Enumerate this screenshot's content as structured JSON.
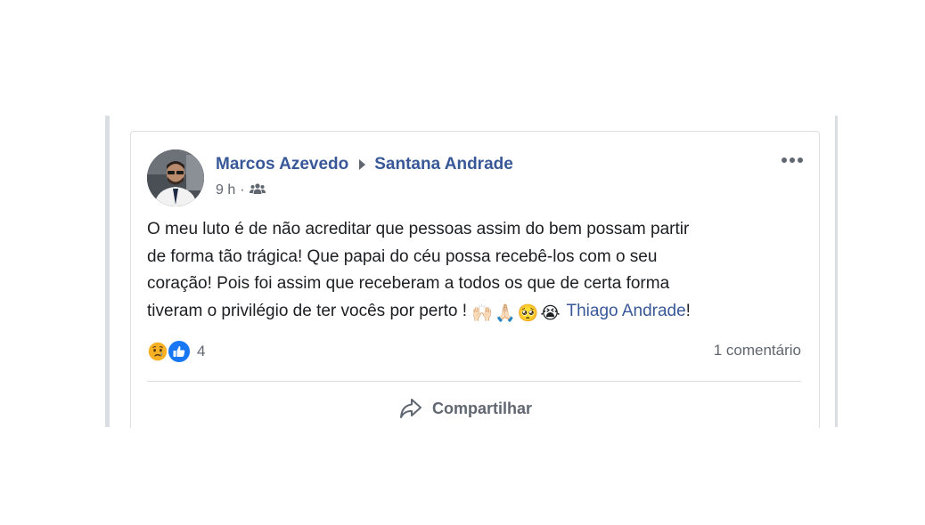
{
  "post": {
    "author": "Marcos Azevedo",
    "recipient": "Santana Andrade",
    "time": "9 h",
    "separator": "·",
    "audience_icon": "friends-icon",
    "more_icon": "more-options-icon",
    "text_lines": [
      "O meu luto é de não acreditar que pessoas assim do bem possam partir",
      "de forma tão trágica! Que papai do céu possa recebê-los com o seu",
      "coração! Pois foi assim que receberam a todos os que de certa forma",
      "tiveram o privilégio de ter vocês por perto ! "
    ],
    "emojis": [
      "🙌🏻",
      "🙏🏻",
      "🥺",
      "😭"
    ],
    "mention": "Thiago Andrade",
    "mention_suffix": "!"
  },
  "reactions": {
    "icons": [
      "sad-reaction-icon",
      "like-reaction-icon"
    ],
    "count": "4"
  },
  "comments": {
    "count_label": "1 comentário"
  },
  "actions": {
    "share_label": "Compartilhar",
    "share_icon": "share-arrow-icon"
  },
  "colors": {
    "link": "#385898",
    "text": "#1c1e21",
    "muted": "#606770",
    "like_blue": "#1877f2",
    "sad_yellow": "#f7b125"
  }
}
